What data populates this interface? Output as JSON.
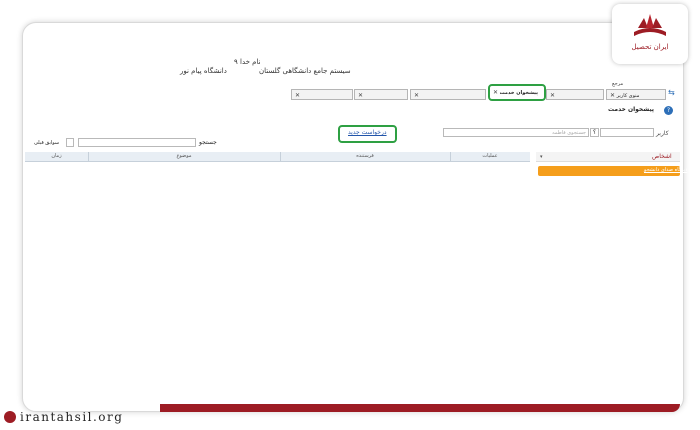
{
  "header": {
    "system_name": "سیستم جامع دانشگاهی گلستان",
    "university": "دانشگاه پیام نور",
    "greeting": "۹ نام خدا"
  },
  "tabs_row1": [
    {
      "label": "منوی کاربر"
    },
    {
      "label": "پیشخوان خدمت"
    },
    {
      "label": "مرجع"
    }
  ],
  "page": {
    "title": "پیشخوان خدمت",
    "user_label": "کاربر",
    "search_placeholder": "جستجوی فاطمه",
    "help_label": "؟",
    "request_new": "درخواست جدید",
    "search_label": "جستجو",
    "history_label": "سوابق قبلی"
  },
  "side": {
    "section_label": "اشخاص",
    "item_label": "دیدگاه صدای دانشجو"
  },
  "table": {
    "columns": [
      "عملیات",
      "فرستنده",
      "موضوع",
      "زمان"
    ]
  },
  "branding": {
    "logo_text": "ایران تحصیل",
    "url": "irantahsil.org"
  },
  "colors": {
    "brand": "#9d1c24",
    "highlight": "#2ea043",
    "orange": "#f59e1b",
    "icon_blue": "#2d6fb8"
  }
}
